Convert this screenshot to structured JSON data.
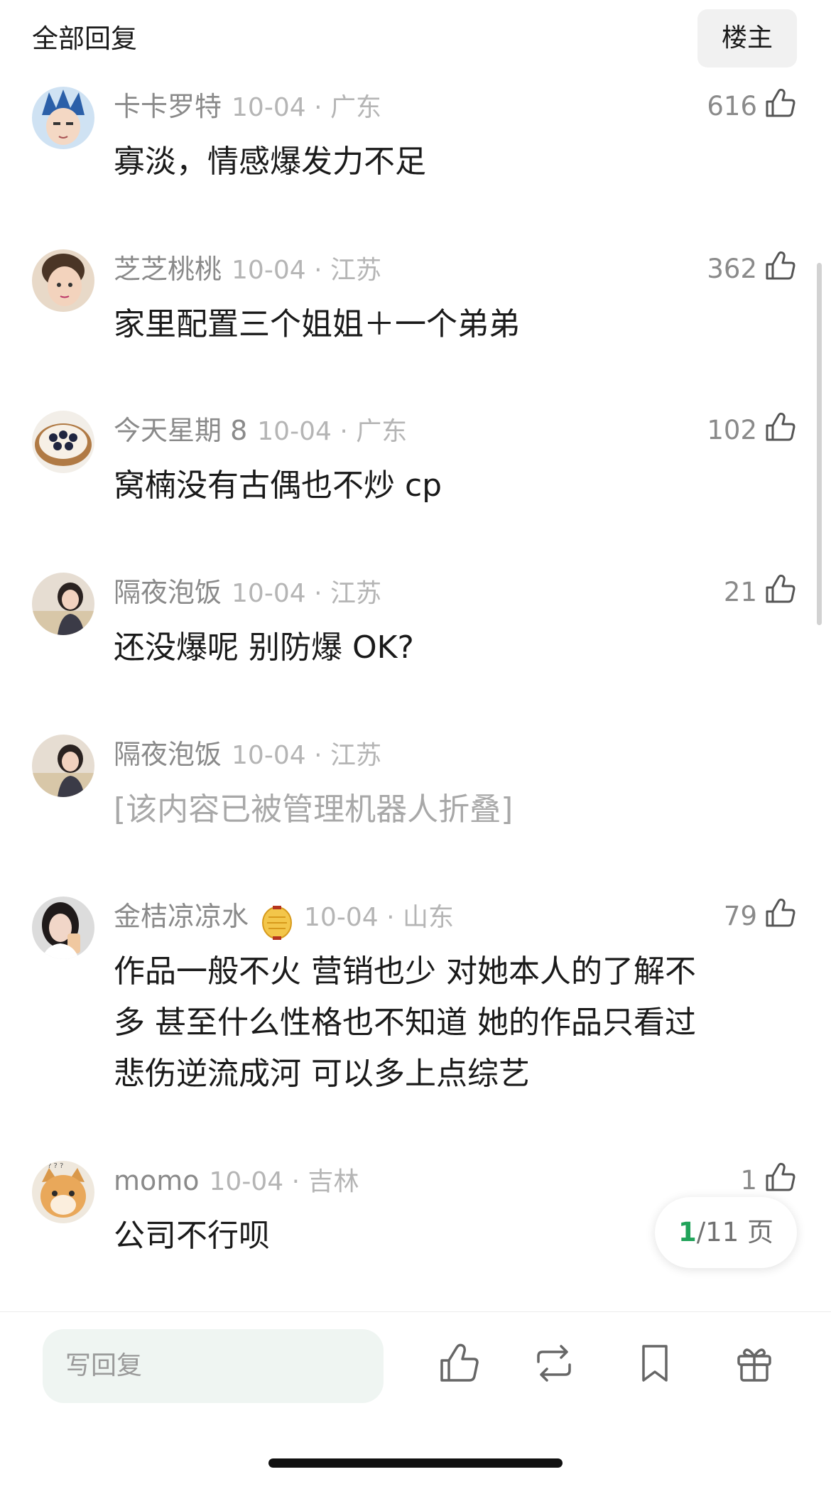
{
  "header": {
    "title": "全部回复",
    "op_label": "楼主"
  },
  "comments": [
    {
      "username": "卡卡罗特",
      "badge": "",
      "date_location": "10-04 · 广东",
      "likes": "616",
      "content": "寡淡，情感爆发力不足",
      "folded": false,
      "avatar": "anime-character-avatar"
    },
    {
      "username": "芝芝桃桃",
      "badge": "",
      "date_location": "10-04 · 江苏",
      "likes": "362",
      "content": "家里配置三个姐姐＋一个弟弟",
      "folded": false,
      "avatar": "child-photo-avatar"
    },
    {
      "username": "今天星期 8",
      "badge": "",
      "date_location": "10-04 · 广东",
      "likes": "102",
      "content": "窝楠没有古偶也不炒 cp",
      "folded": false,
      "avatar": "blueberry-cake-avatar"
    },
    {
      "username": "隔夜泡饭",
      "badge": "",
      "date_location": "10-04 · 江苏",
      "likes": "21",
      "content": "还没爆呢 别防爆 OK?",
      "folded": false,
      "avatar": "girl-photo-avatar"
    },
    {
      "username": "隔夜泡饭",
      "badge": "",
      "date_location": "10-04 · 江苏",
      "likes": "",
      "content": "[该内容已被管理机器人折叠]",
      "folded": true,
      "avatar": "girl-photo-avatar"
    },
    {
      "username": "金桔凉凉水",
      "badge": "lantern-badge-icon",
      "date_location": "10-04 · 山东",
      "likes": "79",
      "content": "作品一般不火  营销也少 对她本人的了解不\n多 甚至什么性格也不知道 她的作品只看过\n悲伤逆流成河  可以多上点综艺",
      "folded": false,
      "avatar": "selfie-photo-avatar"
    },
    {
      "username": "momo",
      "badge": "",
      "date_location": "10-04 · 吉林",
      "likes": "1",
      "content": "公司不行呗",
      "folded": false,
      "avatar": "cat-photo-avatar"
    }
  ],
  "pagination": {
    "current": "1",
    "total_text": "/11 页"
  },
  "bottom_bar": {
    "reply_placeholder": "写回复",
    "icons": [
      "like-icon",
      "repost-icon",
      "bookmark-icon",
      "gift-icon"
    ]
  },
  "colors": {
    "accent_green": "#21a35a",
    "muted_text": "#8a8a8a",
    "light_text": "#b5b5b5",
    "input_bg": "#eff5f2"
  }
}
